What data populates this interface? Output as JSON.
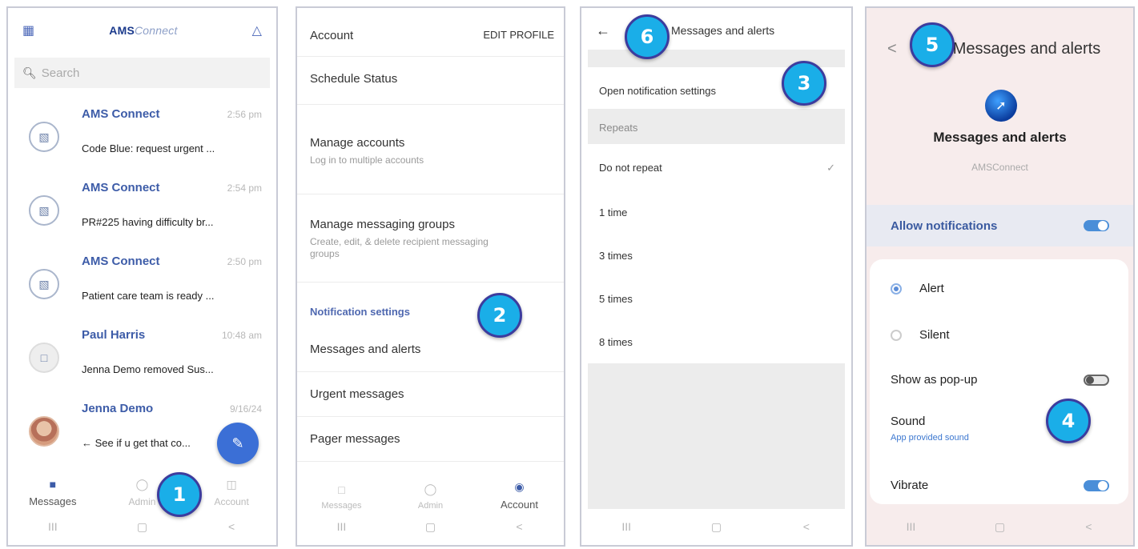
{
  "panel1": {
    "logo_main": "AMS",
    "logo_tail": "Connect",
    "search_placeholder": "Search",
    "conversations": [
      {
        "sender": "AMS Connect",
        "time": "2:56 pm",
        "preview": "Code Blue: request urgent ..."
      },
      {
        "sender": "AMS Connect",
        "time": "2:54 pm",
        "preview": "PR#225 having difficulty br..."
      },
      {
        "sender": "AMS Connect",
        "time": "2:50 pm",
        "preview": "Patient care team is ready ..."
      },
      {
        "sender": "Paul Harris",
        "time": "10:48 am",
        "preview": "Jenna Demo removed Sus..."
      },
      {
        "sender": "Jenna Demo",
        "time": "9/16/24",
        "preview": "← See if u get that co..."
      }
    ],
    "tabs": {
      "messages": "Messages",
      "admin": "Admin",
      "account": "Account"
    }
  },
  "panel2": {
    "account_label": "Account",
    "edit_profile": "EDIT PROFILE",
    "schedule_status": "Schedule Status",
    "manage_accounts": "Manage accounts",
    "manage_accounts_sub": "Log in to multiple accounts",
    "manage_groups": "Manage messaging groups",
    "manage_groups_sub": "Create, edit, & delete recipient messaging groups",
    "notification_settings": "Notification settings",
    "messages_alerts": "Messages and alerts",
    "urgent_messages": "Urgent messages",
    "pager_messages": "Pager messages",
    "tabs": {
      "messages": "Messages",
      "admin": "Admin",
      "account": "Account"
    }
  },
  "panel3": {
    "title": "Messages and alerts",
    "open_settings": "Open notification settings",
    "repeats_label": "Repeats",
    "options": [
      "Do not repeat",
      "1 time",
      "3 times",
      "5 times",
      "8 times"
    ]
  },
  "panel4": {
    "title": "Messages and alerts",
    "app_title": "Messages and alerts",
    "app_name": "AMSConnect",
    "allow_notifications": "Allow notifications",
    "alert": "Alert",
    "silent": "Silent",
    "show_popup": "Show as pop-up",
    "sound": "Sound",
    "sound_sub": "App provided sound",
    "vibrate": "Vibrate"
  },
  "badges": {
    "b1": "1",
    "b2": "2",
    "b3": "3",
    "b4": "4",
    "b5": "5",
    "b6": "6"
  },
  "navbar": {
    "recent": "III",
    "home": "▢",
    "back": "<"
  },
  "colors": {
    "badge": "#1aaee8",
    "accent": "#3d5ca8",
    "toggle_on": "#4a8ed8"
  }
}
